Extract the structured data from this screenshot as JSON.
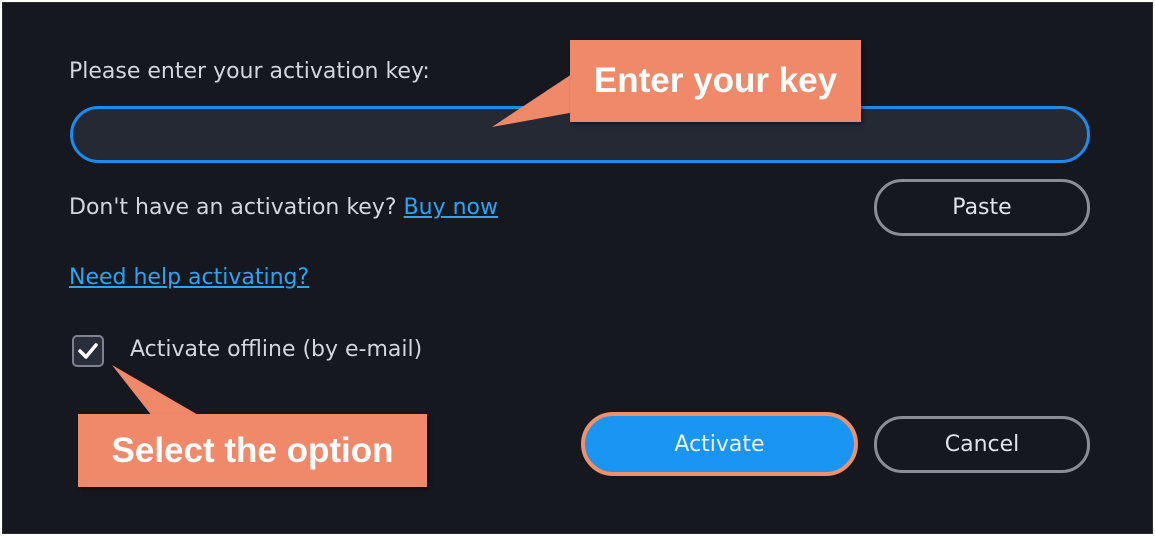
{
  "dialog": {
    "prompt_label": "Please enter your activation key:",
    "key_input": {
      "value": "",
      "placeholder": ""
    },
    "no_key_text": "Don't have an activation key?",
    "buy_now_link": "Buy now",
    "paste_button": "Paste",
    "help_link": "Need help activating?",
    "offline_checkbox": {
      "checked": true,
      "label": "Activate offline (by e-mail)"
    },
    "activate_button": "Activate",
    "cancel_button": "Cancel"
  },
  "annotations": {
    "top_callout": "Enter your key",
    "bottom_callout": "Select the option",
    "callout_color": "#f0896a"
  },
  "colors": {
    "dialog_background": "#16181f",
    "accent_blue": "#1a95f2",
    "link_blue": "#2aa5f5"
  }
}
